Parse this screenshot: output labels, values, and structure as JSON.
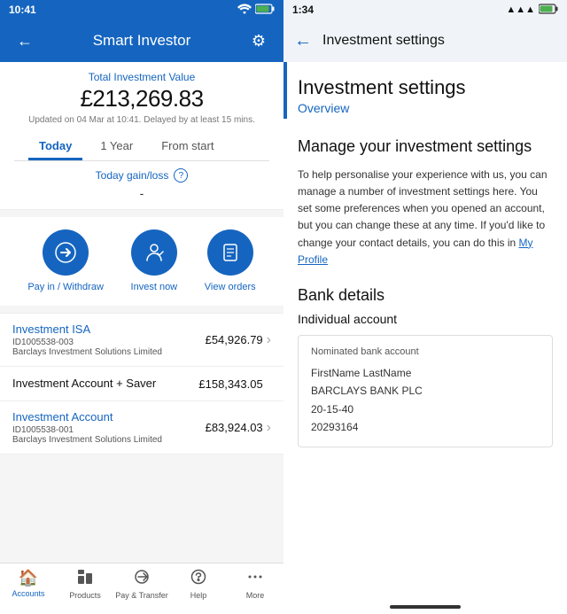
{
  "left": {
    "statusBar": {
      "time": "10:41",
      "icons": "wifi battery"
    },
    "header": {
      "title": "Smart Investor",
      "backIcon": "←",
      "settingsIcon": "⚙"
    },
    "totalInvestment": {
      "label": "Total Investment Value",
      "amount": "£213,269.83",
      "updated": "Updated on 04 Mar at 10:41. Delayed by at least 15 mins."
    },
    "tabs": [
      {
        "label": "Today",
        "active": true
      },
      {
        "label": "1 Year",
        "active": false
      },
      {
        "label": "From start",
        "active": false
      }
    ],
    "gainLoss": {
      "label": "Today gain/loss",
      "value": "-"
    },
    "actions": [
      {
        "label": "Pay in /\nWithdraw",
        "icon": "→"
      },
      {
        "label": "Invest\nnow",
        "icon": "👤"
      },
      {
        "label": "View\norders",
        "icon": "📋"
      }
    ],
    "accounts": [
      {
        "name": "Investment ISA",
        "id": "ID1005538-003",
        "provider": "Barclays Investment Solutions Limited",
        "amount": "£54,926.79",
        "hasChevron": true,
        "nameBlue": true
      },
      {
        "name": "Investment Account + Saver",
        "id": "",
        "provider": "",
        "amount": "£158,343.05",
        "hasChevron": false,
        "nameBlue": false
      },
      {
        "name": "Investment Account",
        "id": "ID1005538-001",
        "provider": "Barclays Investment Solutions Limited",
        "amount": "£83,924.03",
        "hasChevron": true,
        "nameBlue": true
      }
    ],
    "bottomNav": [
      {
        "icon": "🏠",
        "label": "Accounts",
        "active": true
      },
      {
        "icon": "📦",
        "label": "Products",
        "active": false
      },
      {
        "icon": "↔",
        "label": "Pay & Transfer",
        "active": false
      },
      {
        "icon": "❓",
        "label": "Help",
        "active": false
      },
      {
        "icon": "···",
        "label": "More",
        "active": false
      }
    ]
  },
  "right": {
    "statusBar": {
      "time": "1:34",
      "icons": "wifi battery"
    },
    "header": {
      "backIcon": "←",
      "title": "Investment settings"
    },
    "pageTitle": "Investment settings",
    "pageSubtitle": "Overview",
    "manageTitle": "Manage your investment settings",
    "manageDesc": "To help personalise your experience with us, you can manage a number of investment settings here. You set some preferences when you opened an account, but you can change these at any time. If you'd like to change your contact details, you can do this in",
    "myProfileLink": "My Profile",
    "bankDetailsTitle": "Bank details",
    "individualAccountTitle": "Individual account",
    "nominatedBankLabel": "Nominated bank account",
    "bankName": "FirstName LastName",
    "bankInst": "BARCLAYS BANK PLC",
    "sortCode": "20-15-40",
    "accountNumber": "20293164"
  }
}
